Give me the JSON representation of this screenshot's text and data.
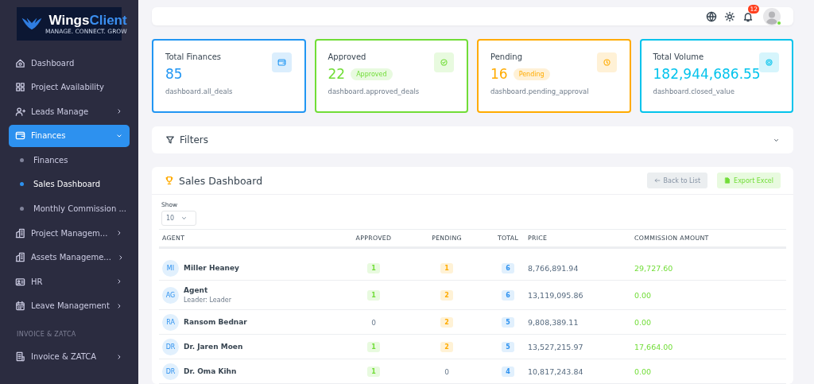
{
  "logo": {
    "name": "Wings",
    "accent": "Client",
    "tagline": "MANAGE. CONNECT. GROW"
  },
  "sidebar": {
    "items": [
      {
        "kind": "link",
        "label": "Dashboard"
      },
      {
        "kind": "link",
        "label": "Project Availability"
      },
      {
        "kind": "group",
        "label": "Leads Manage",
        "expanded": false,
        "selected": false
      },
      {
        "kind": "group",
        "label": "Finances",
        "expanded": true,
        "selected": true,
        "children": [
          {
            "label": "Finances",
            "selected": false
          },
          {
            "label": "Sales Dashboard",
            "selected": true
          },
          {
            "label": "Monthly Commission ...",
            "selected": false
          }
        ]
      },
      {
        "kind": "group",
        "label": "Project Managem...",
        "expanded": false,
        "selected": false
      },
      {
        "kind": "group",
        "label": "Assets Manageme...",
        "expanded": false,
        "selected": false
      },
      {
        "kind": "group",
        "label": "HR",
        "expanded": false,
        "selected": false
      },
      {
        "kind": "group",
        "label": "Leave Management",
        "expanded": false,
        "selected": false
      },
      {
        "kind": "section",
        "label": "INVOICE & ZATCA"
      },
      {
        "kind": "group",
        "label": "Invoice & ZATCA",
        "expanded": false,
        "selected": false
      }
    ]
  },
  "topbar": {
    "notification_count": "12",
    "user_online": true
  },
  "stats": [
    {
      "title": "Total Finances",
      "value": "85",
      "caption": "dashboard.all_deals",
      "color": "#2196f3"
    },
    {
      "title": "Approved",
      "value": "22",
      "badge": "Approved",
      "caption": "dashboard.approved_deals",
      "color": "#71dd37"
    },
    {
      "title": "Pending",
      "value": "16",
      "badge": "Pending",
      "caption": "dashboard.pending_approval",
      "color": "#ffab00"
    },
    {
      "title": "Total Volume",
      "value": "182,944,686.55",
      "caption": "dashboard.closed_value",
      "color": "#03c3ec"
    }
  ],
  "filters": {
    "title": "Filters",
    "expanded": false
  },
  "sales": {
    "title": "Sales Dashboard",
    "buttons": [
      {
        "kind": "back",
        "label": "Back to List"
      },
      {
        "kind": "export",
        "label": "Export Excel"
      }
    ],
    "show_label": "Show",
    "page_size": "10",
    "columns": [
      "AGENT",
      "APPROVED",
      "PENDING",
      "TOTAL",
      "PRICE",
      "COMMISSION AMOUNT"
    ],
    "rows": [
      {
        "initials": "MI",
        "name": "Miller Heaney",
        "approved": {
          "value": "1",
          "badge": true
        },
        "pending": {
          "value": "1",
          "badge": true
        },
        "total": "6",
        "price": "8,766,891.94",
        "commission": "29,727.60"
      },
      {
        "initials": "AG",
        "name": "Agent",
        "subtitle": "Leader: Leader",
        "approved": {
          "value": "1",
          "badge": true
        },
        "pending": {
          "value": "2",
          "badge": true
        },
        "total": "6",
        "price": "13,119,095.86",
        "commission": "0.00"
      },
      {
        "initials": "RA",
        "name": "Ransom Bednar",
        "approved": {
          "value": "0",
          "badge": false
        },
        "pending": {
          "value": "2",
          "badge": true
        },
        "total": "5",
        "price": "9,808,389.11",
        "commission": "0.00"
      },
      {
        "initials": "DR",
        "name": "Dr. Jaren Moen",
        "approved": {
          "value": "1",
          "badge": true
        },
        "pending": {
          "value": "2",
          "badge": true
        },
        "total": "5",
        "price": "13,527,215.97",
        "commission": "17,664.00"
      },
      {
        "initials": "DR",
        "name": "Dr. Oma Kihn",
        "approved": {
          "value": "1",
          "badge": true
        },
        "pending": {
          "value": "0",
          "badge": false
        },
        "total": "4",
        "price": "10,817,243.84",
        "commission": "0.00"
      }
    ]
  }
}
